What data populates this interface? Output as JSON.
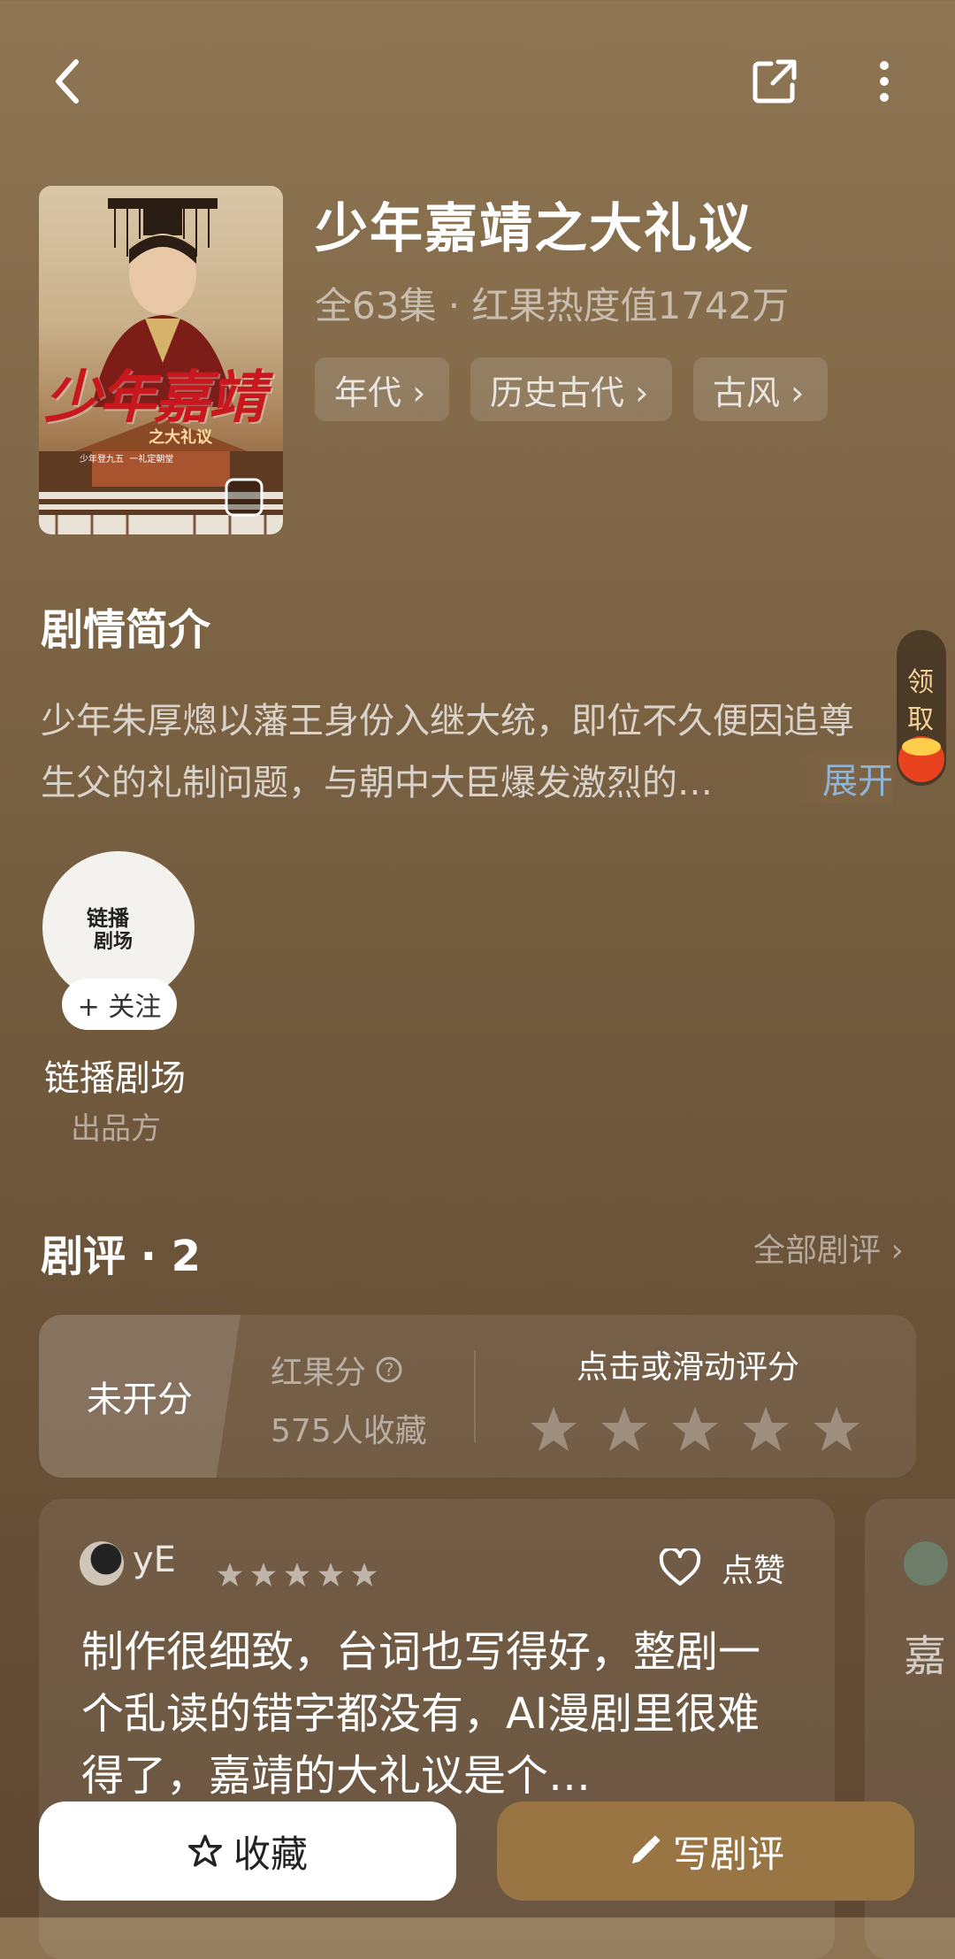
{
  "header": {
    "back_icon": "chevron-left-icon",
    "share_icon": "share-icon",
    "more_icon": "more-vertical-icon"
  },
  "drama": {
    "title": "少年嘉靖之大礼议",
    "meta": "全63集 · 红果热度值1742万",
    "tags": [
      "年代 ›",
      "历史古代 ›",
      "古风 ›"
    ],
    "poster_title": "少年嘉靖",
    "poster_subtitle": "之大礼议",
    "poster_caption": "少年登九五  一礼定朝堂"
  },
  "synopsis": {
    "heading": "剧情简介",
    "text": "少年朱厚熜以藩王身份入继大统，即位不久便因追尊生父的礼制问题，与朝中大臣爆发激烈的…",
    "expand_label": "展开"
  },
  "side_widget": {
    "line1": "领",
    "line2": "取"
  },
  "producer": {
    "logo_text_1": "链播",
    "logo_text_2": "剧场",
    "follow_label": "+ 关注",
    "name": "链播剧场",
    "role": "出品方"
  },
  "reviews": {
    "heading": "剧评 · 2",
    "all_label": "全部剧评 ›",
    "score_label": "未开分",
    "hongguo_label": "红果分",
    "collect_count": "575人收藏",
    "rate_prompt": "点击或滑动评分",
    "items": [
      {
        "user": "yE",
        "stars": 5,
        "like_label": "点赞",
        "text": "制作很细致，台词也写得好，整剧一个乱读的错字都没有，AI漫剧里很难得了，嘉靖的大礼议是个…"
      },
      {
        "text": "嘉"
      }
    ]
  },
  "bottom_bar": {
    "favorite_label": "收藏",
    "write_label": "写剧评"
  },
  "colors": {
    "accent_button": "#9a7544",
    "expand_link": "#8fb4d9",
    "poster_red": "#c8171d"
  }
}
